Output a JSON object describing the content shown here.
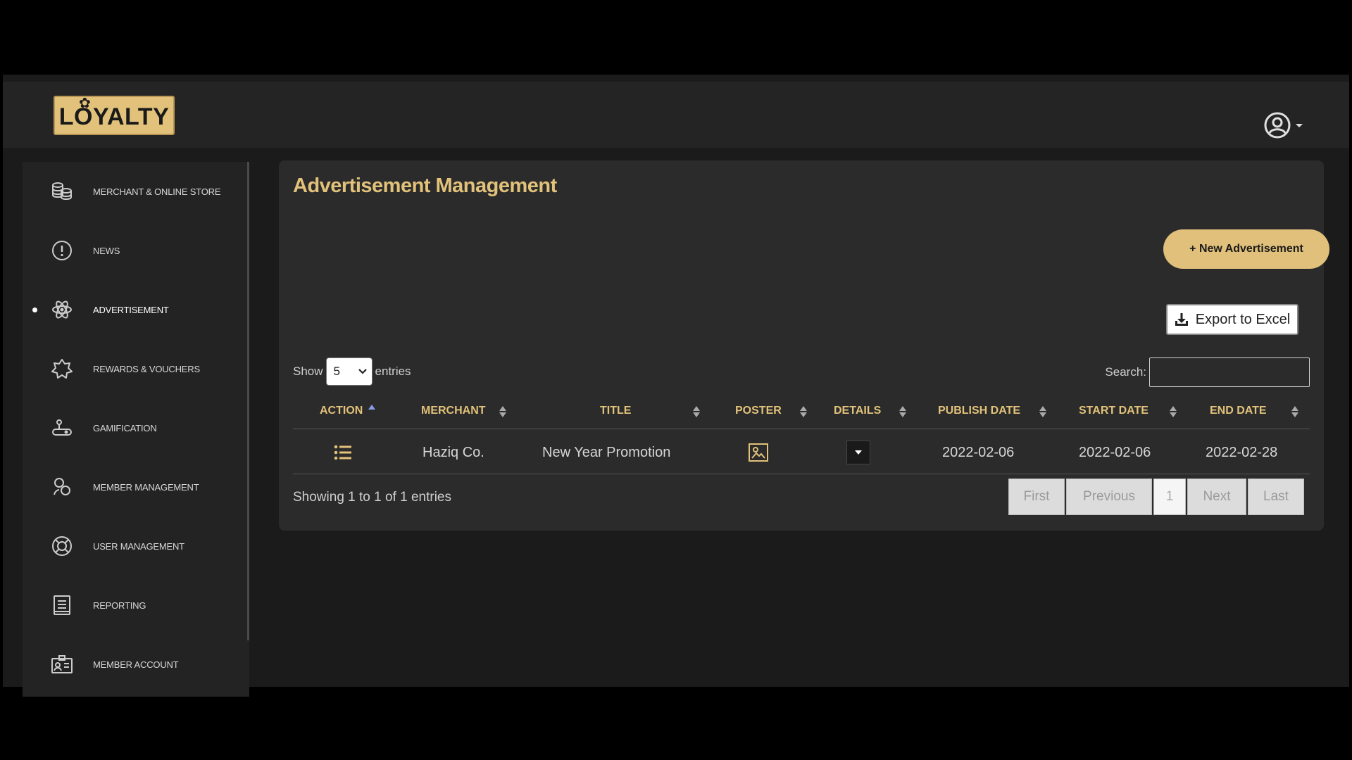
{
  "brand": {
    "logo_text": "LOYALTY"
  },
  "sidebar": {
    "items": [
      {
        "label": "MERCHANT & ONLINE STORE",
        "icon": "coins-stack-icon",
        "active": false
      },
      {
        "label": "NEWS",
        "icon": "alert-circle-icon",
        "active": false
      },
      {
        "label": "ADVERTISEMENT",
        "icon": "atom-icon",
        "active": true
      },
      {
        "label": "REWARDS & VOUCHERS",
        "icon": "badge-star-icon",
        "active": false
      },
      {
        "label": "GAMIFICATION",
        "icon": "joystick-icon",
        "active": false
      },
      {
        "label": "MEMBER MANAGEMENT",
        "icon": "members-icon",
        "active": false
      },
      {
        "label": "USER MANAGEMENT",
        "icon": "lifebuoy-icon",
        "active": false
      },
      {
        "label": "REPORTING",
        "icon": "report-icon",
        "active": false
      },
      {
        "label": "MEMBER ACCOUNT",
        "icon": "id-card-icon",
        "active": false
      }
    ]
  },
  "main": {
    "title": "Advertisement Management",
    "new_button": "+ New Advertisement",
    "export_button": "Export to Excel",
    "show_label": "Show",
    "entries_label": "entries",
    "page_size": "5",
    "search_label": "Search:",
    "search_value": "",
    "columns": [
      "ACTION",
      "MERCHANT",
      "TITLE",
      "POSTER",
      "DETAILS",
      "PUBLISH DATE",
      "START DATE",
      "END DATE"
    ],
    "rows": [
      {
        "merchant": "Haziq Co.",
        "title": "New Year Promotion",
        "publish_date": "2022-02-06",
        "start_date": "2022-02-06",
        "end_date": "2022-02-28"
      }
    ],
    "info": "Showing 1 to 1 of 1 entries",
    "pagination": {
      "first": "First",
      "previous": "Previous",
      "current": "1",
      "next": "Next",
      "last": "Last"
    }
  },
  "colors": {
    "accent": "#e2c27a",
    "background": "#1b1b1b",
    "panel": "#2b2b2b",
    "sort_active": "#8a9ee8"
  }
}
